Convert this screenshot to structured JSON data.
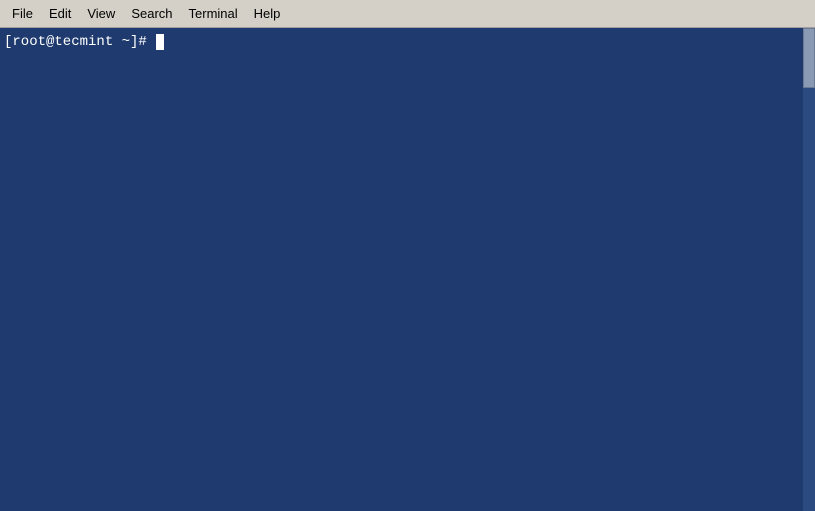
{
  "menubar": {
    "items": [
      {
        "label": "File",
        "id": "file"
      },
      {
        "label": "Edit",
        "id": "edit"
      },
      {
        "label": "View",
        "id": "view"
      },
      {
        "label": "Search",
        "id": "search"
      },
      {
        "label": "Terminal",
        "id": "terminal"
      },
      {
        "label": "Help",
        "id": "help"
      }
    ]
  },
  "terminal": {
    "prompt": "[root@tecmint ~]# "
  }
}
